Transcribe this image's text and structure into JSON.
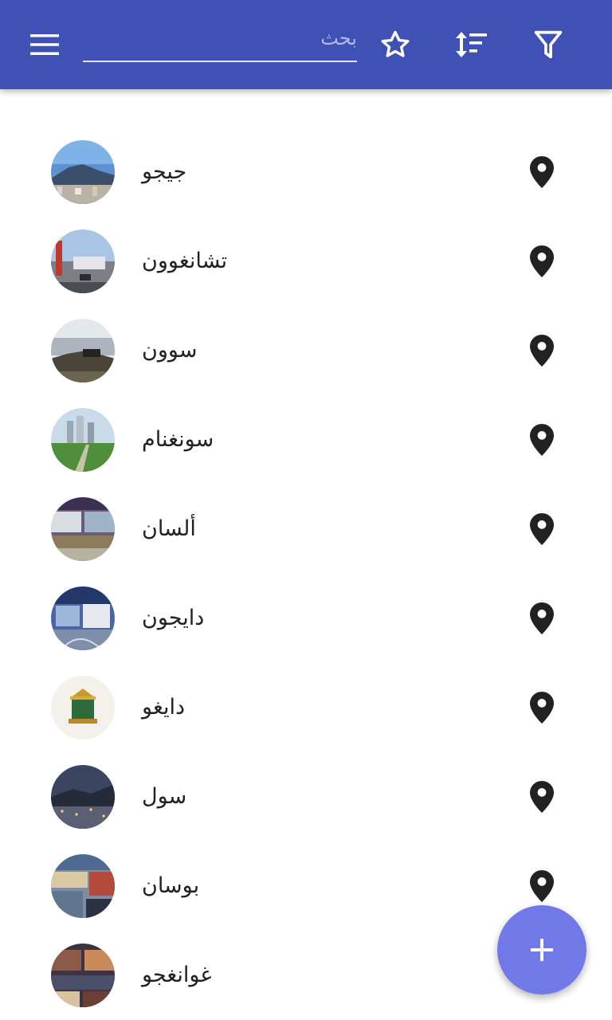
{
  "app_bar": {
    "background_color": "#3f51b5",
    "menu_icon": "menu-icon",
    "search": {
      "placeholder": "بحث",
      "value": ""
    },
    "actions": [
      {
        "name": "favorites",
        "icon": "star-outline-icon"
      },
      {
        "name": "sort",
        "icon": "sort-icon"
      },
      {
        "name": "filter",
        "icon": "filter-icon"
      }
    ]
  },
  "cities": [
    {
      "name": "جيجو",
      "pin_icon": "map-pin-icon"
    },
    {
      "name": "تشانغوون",
      "pin_icon": "map-pin-icon"
    },
    {
      "name": "سوون",
      "pin_icon": "map-pin-icon"
    },
    {
      "name": "سونغنام",
      "pin_icon": "map-pin-icon"
    },
    {
      "name": "ألسان",
      "pin_icon": "map-pin-icon"
    },
    {
      "name": "دايجون",
      "pin_icon": "map-pin-icon"
    },
    {
      "name": "دايغو",
      "pin_icon": "map-pin-icon"
    },
    {
      "name": "سول",
      "pin_icon": "map-pin-icon"
    },
    {
      "name": "بوسان",
      "pin_icon": "map-pin-icon"
    },
    {
      "name": "غوانغجو",
      "pin_icon": "map-pin-icon"
    }
  ],
  "fab": {
    "icon": "plus-icon",
    "color": "#7179e8"
  }
}
